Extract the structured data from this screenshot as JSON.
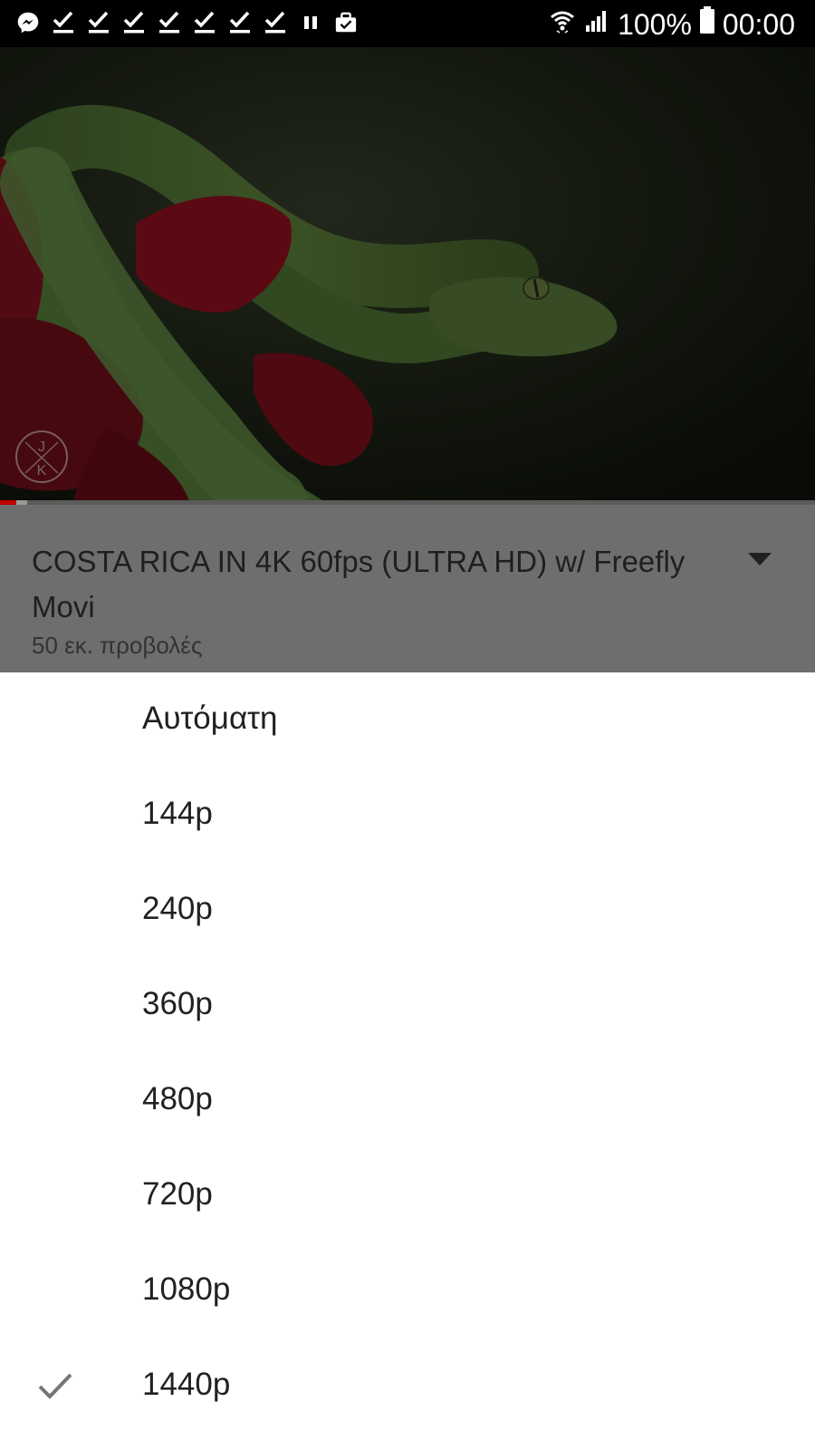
{
  "status_bar": {
    "left_icons": [
      "messenger-icon",
      "check-icon",
      "check-icon",
      "check-icon",
      "check-icon",
      "check-icon",
      "check-icon",
      "check-icon",
      "pause-icon",
      "briefcase-icon"
    ],
    "battery_text": "100%",
    "time": "00:00"
  },
  "video": {
    "watermark_letters": "J K",
    "progress": 0.02,
    "title": "COSTA RICA IN 4K 60fps (ULTRA HD) w/ Freefly Movi",
    "views": "50 εκ. προβολές"
  },
  "quality_menu": {
    "selected": "1440p",
    "options": [
      {
        "label": "Αυτόματη"
      },
      {
        "label": "144p"
      },
      {
        "label": "240p"
      },
      {
        "label": "360p"
      },
      {
        "label": "480p"
      },
      {
        "label": "720p"
      },
      {
        "label": "1080p"
      },
      {
        "label": "1440p"
      }
    ]
  },
  "colors": {
    "status_bar_bg": "#000000",
    "dim_overlay": "#6e6e6e",
    "sheet_bg": "#ffffff",
    "progress": "#c00000"
  }
}
